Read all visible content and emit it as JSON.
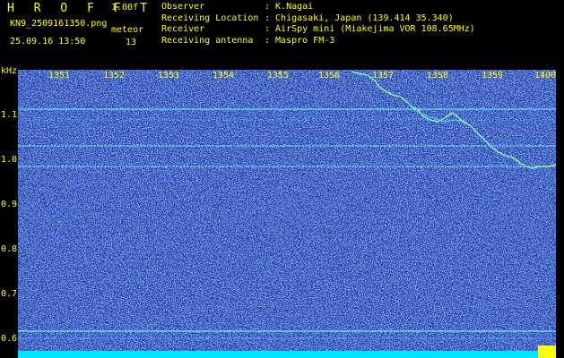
{
  "header": {
    "app_title": "H R O F F T",
    "version": "1.00f",
    "file_name": "KN9_2509161350.png",
    "timestamp": "25.09.16 13:50",
    "meteor_label": "meteor",
    "meteor_count": "13"
  },
  "info": [
    {
      "key": "Observer",
      "value": ": K.Nagai"
    },
    {
      "key": "Receiving Location",
      "value": ": Chigasaki, Japan (139.414 35.340)"
    },
    {
      "key": "Receiver",
      "value": ": AirSpy mini (Miakejima VOR 108.65MHz)"
    },
    {
      "key": "Receiving antenna",
      "value": ": Maspro FM-3"
    }
  ],
  "axis": {
    "y_unit": "kHz",
    "y_ticks": [
      "1.1",
      "1.0",
      "0.9",
      "0.8",
      "0.7",
      "0.6"
    ],
    "x_ticks": [
      "1351",
      "1352",
      "1353",
      "1354",
      "1355",
      "1356",
      "1357",
      "1358",
      "1359",
      "1400"
    ]
  },
  "colors": {
    "label": "#ffff00",
    "background": "#000000",
    "noise": "#1a2a9c",
    "carrier": "#7ff0ff",
    "floor": "#00e5ff"
  }
}
